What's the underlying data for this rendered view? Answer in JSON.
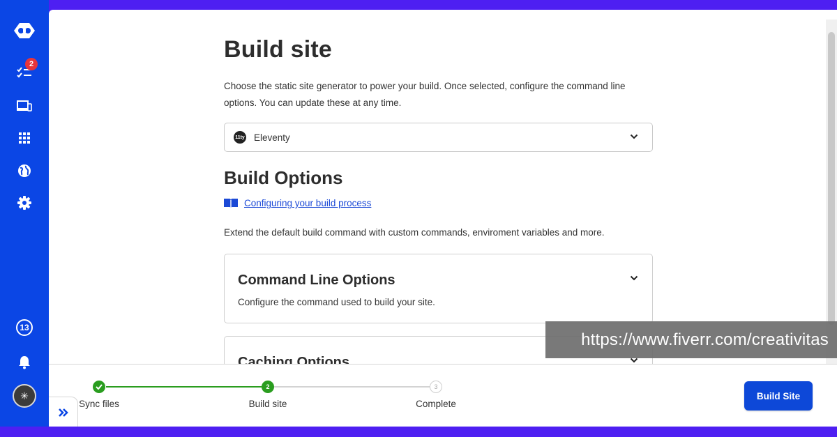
{
  "sidebar": {
    "logo": "netlify-logo-icon",
    "items": [
      {
        "name": "tasks",
        "icon": "checklist-icon",
        "badge": "2"
      },
      {
        "name": "devices",
        "icon": "devices-icon"
      },
      {
        "name": "apps",
        "icon": "grid-icon"
      },
      {
        "name": "domains",
        "icon": "globe-icon"
      },
      {
        "name": "settings",
        "icon": "gear-icon"
      }
    ],
    "bottom": {
      "count": "13",
      "notifications_icon": "bell-icon",
      "avatar_icon": "asterisk-avatar"
    },
    "accent": "#0b46e5"
  },
  "main": {
    "title": "Build site",
    "intro": "Choose the static site generator to power your build. Once selected, configure the command line options. You can update these at any time.",
    "generator_select": {
      "value": "Eleventy",
      "logo_text": "11ty"
    },
    "build_options": {
      "heading": "Build Options",
      "doc_link": "Configuring your build process",
      "description": "Extend the default build command with custom commands, enviroment variables and more."
    },
    "cards": [
      {
        "title": "Command Line Options",
        "description": "Configure the command used to build your site."
      },
      {
        "title": "Caching Options",
        "description": ""
      }
    ]
  },
  "footer": {
    "steps": [
      {
        "label": "Sync files",
        "state": "done",
        "number": "1"
      },
      {
        "label": "Build site",
        "state": "current",
        "number": "2"
      },
      {
        "label": "Complete",
        "state": "todo",
        "number": "3"
      }
    ],
    "primary_button": "Build Site",
    "step_color": "#2a9d1f"
  },
  "watermark": "https://www.fiverr.com/creativitas"
}
